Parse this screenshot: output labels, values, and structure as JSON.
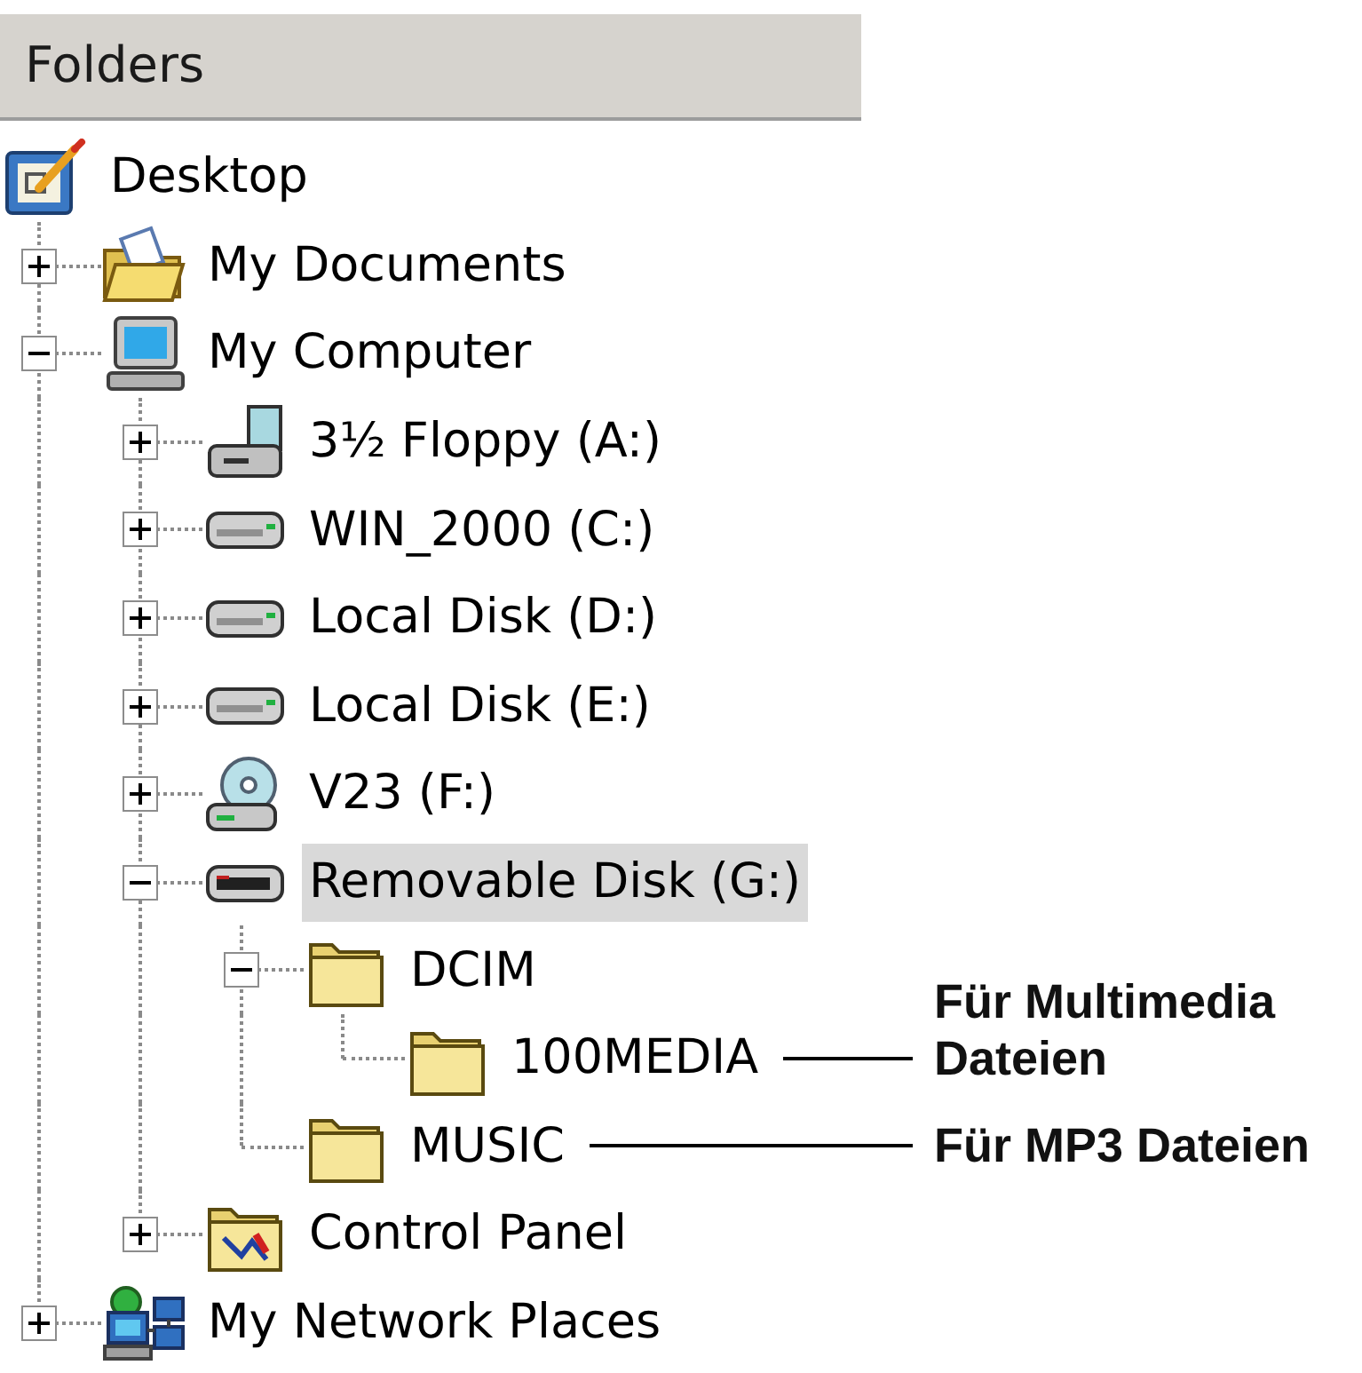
{
  "pane": {
    "title": "Folders"
  },
  "tree": [
    {
      "label": "Desktop",
      "kind": "desktop",
      "selected": false,
      "children": [
        {
          "label": "My Documents",
          "kind": "documents",
          "selected": false,
          "expanded": false
        },
        {
          "label": "My Computer",
          "kind": "computer",
          "selected": false,
          "expanded": true,
          "children": [
            {
              "label": "3½ Floppy (A:)",
              "kind": "floppy",
              "selected": false,
              "expanded": false
            },
            {
              "label": "WIN_2000 (C:)",
              "kind": "drive",
              "selected": false,
              "expanded": false
            },
            {
              "label": "Local Disk (D:)",
              "kind": "drive",
              "selected": false,
              "expanded": false
            },
            {
              "label": "Local Disk (E:)",
              "kind": "drive",
              "selected": false,
              "expanded": false
            },
            {
              "label": "V23 (F:)",
              "kind": "cd",
              "selected": false,
              "expanded": false
            },
            {
              "label": "Removable Disk (G:)",
              "kind": "removable",
              "selected": true,
              "expanded": true,
              "children": [
                {
                  "label": "DCIM",
                  "kind": "folder",
                  "selected": false,
                  "expanded": true,
                  "children": [
                    {
                      "label": "100MEDIA",
                      "kind": "folder",
                      "selected": false,
                      "annotation": "Für Multimedia Dateien"
                    }
                  ]
                },
                {
                  "label": "MUSIC",
                  "kind": "folder",
                  "selected": false,
                  "annotation": "Für MP3 Dateien"
                }
              ]
            },
            {
              "label": "Control Panel",
              "kind": "control-panel",
              "selected": false,
              "expanded": false
            }
          ]
        },
        {
          "label": "My Network Places",
          "kind": "network",
          "selected": false,
          "expanded": false
        }
      ]
    }
  ]
}
